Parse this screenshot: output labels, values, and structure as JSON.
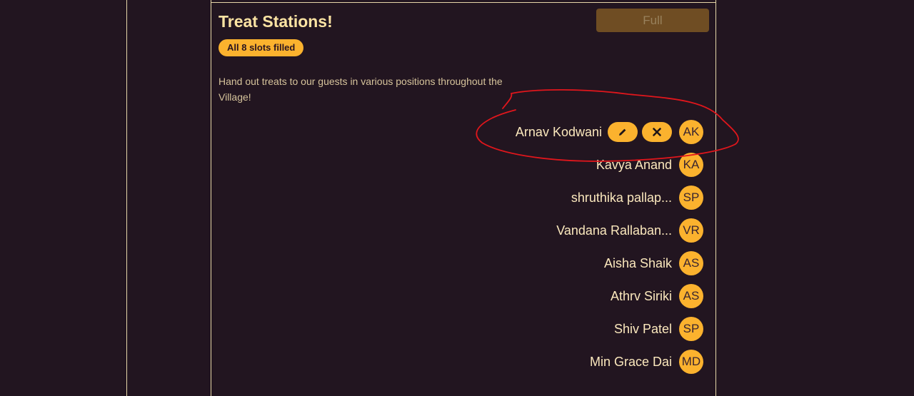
{
  "card": {
    "title": "Treat Stations!",
    "status_button": "Full",
    "slots_badge": "All 8 slots filled",
    "description": "Hand out treats to our guests in various positions throughout the Village!"
  },
  "attendees": [
    {
      "name": "Arnav Kodwani",
      "initials": "AK",
      "is_current_user": true
    },
    {
      "name": "Kavya Anand",
      "initials": "KA"
    },
    {
      "name": "shruthika pallap...",
      "initials": "SP"
    },
    {
      "name": "Vandana Rallaban...",
      "initials": "VR"
    },
    {
      "name": "Aisha Shaik",
      "initials": "AS"
    },
    {
      "name": "Athrv Siriki",
      "initials": "AS"
    },
    {
      "name": "Shiv Patel",
      "initials": "SP"
    },
    {
      "name": "Min Grace Dai",
      "initials": "MD"
    }
  ],
  "icons": {
    "edit": "pencil-icon",
    "remove": "close-icon"
  },
  "colors": {
    "background": "#221520",
    "accent": "#fbb22e",
    "border": "#e6d6a8",
    "annotation": "#e0161c"
  }
}
